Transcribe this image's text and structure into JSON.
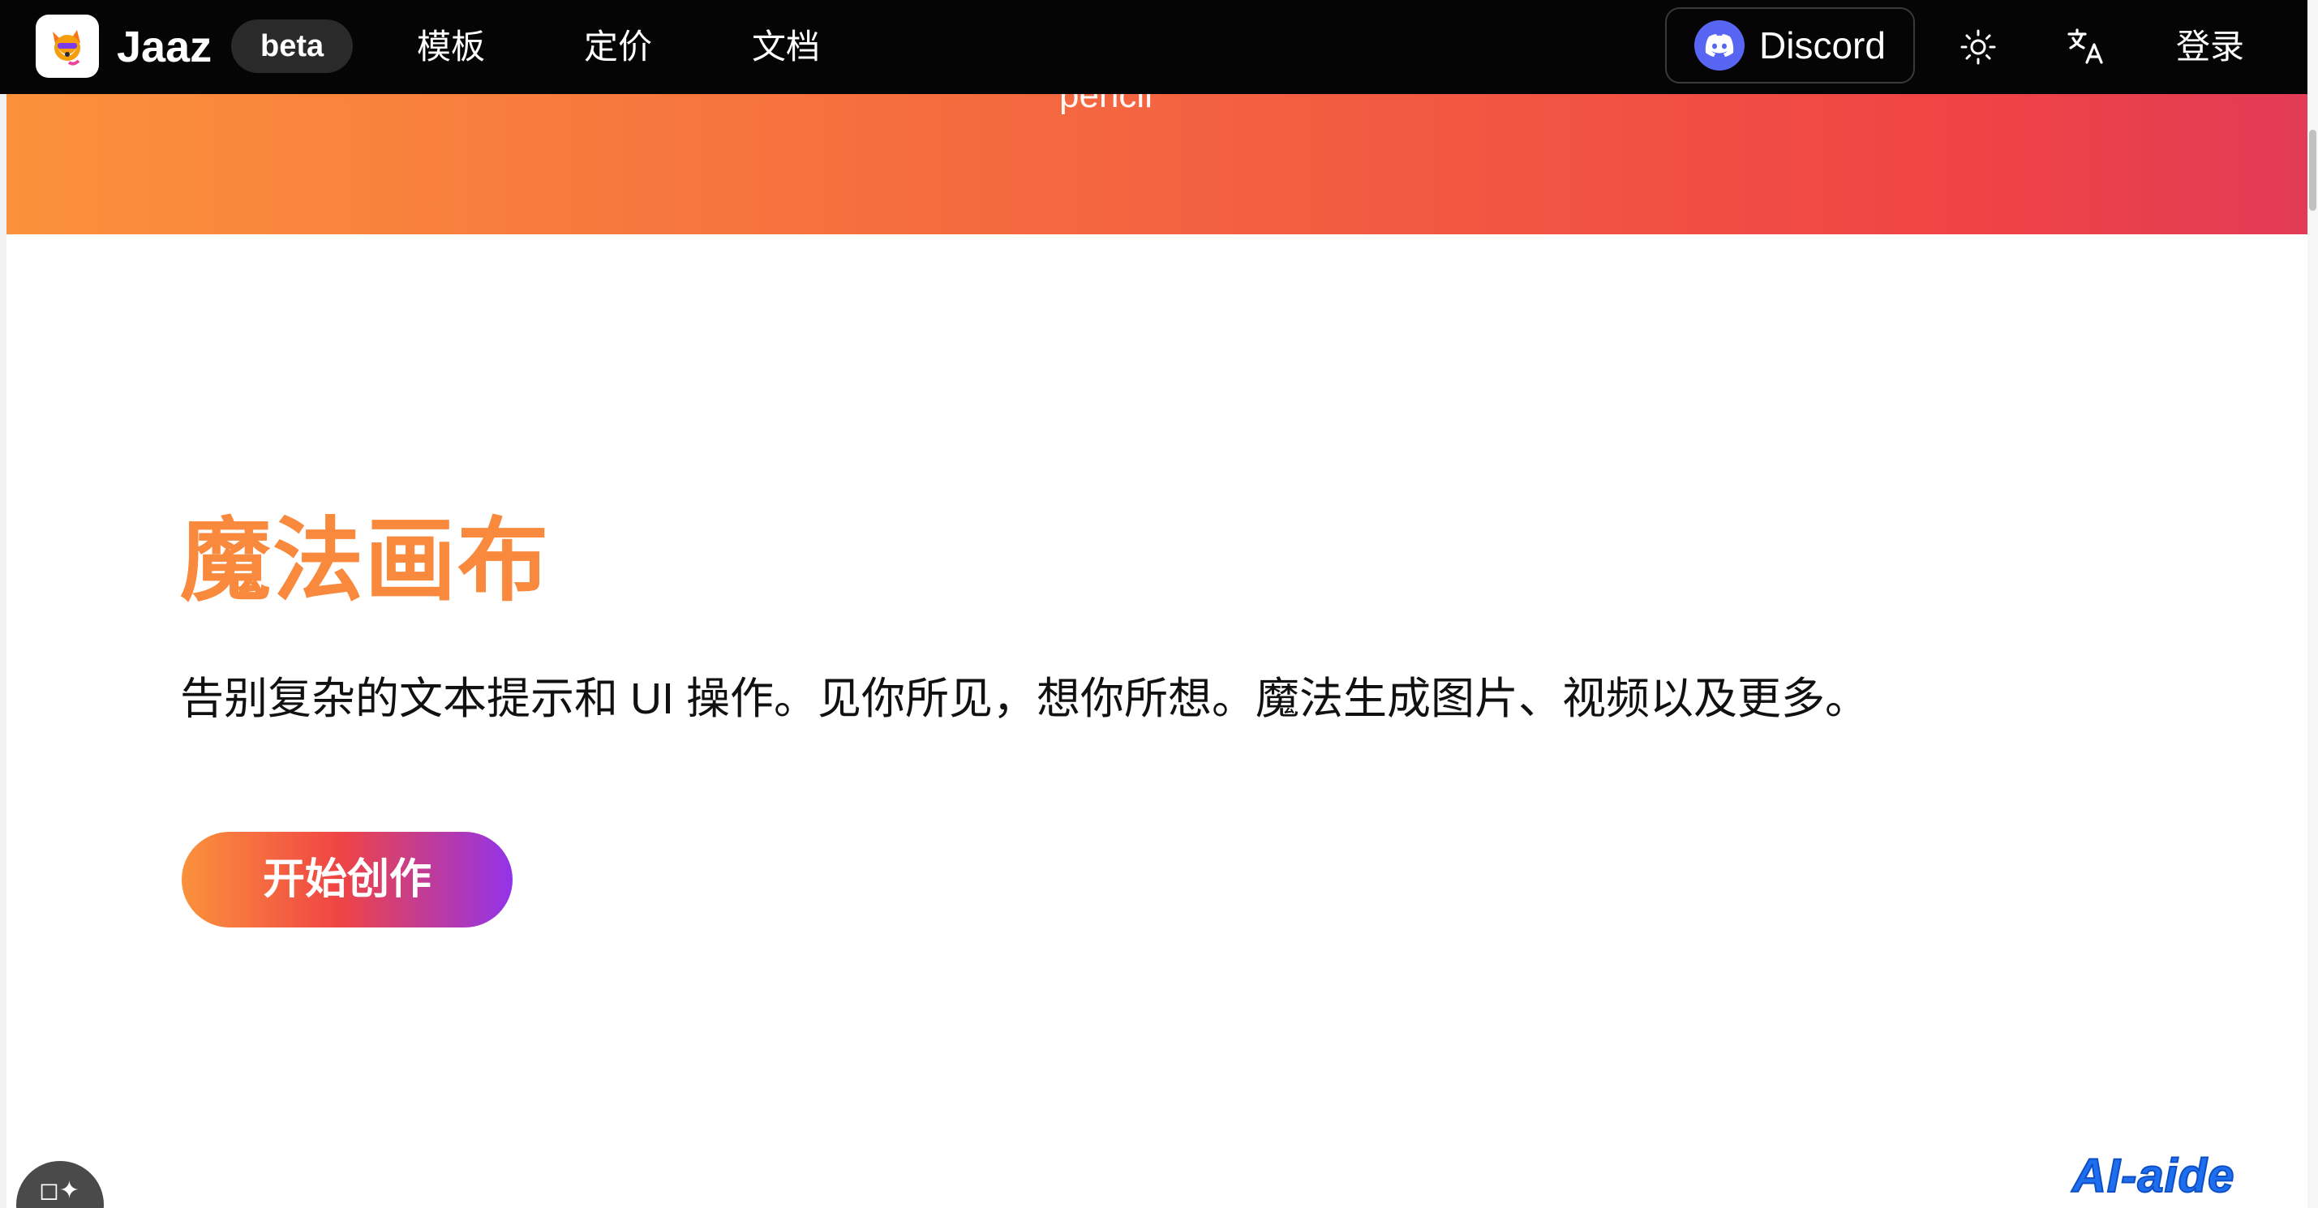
{
  "nav": {
    "brand": "Jaaz",
    "badge": "beta",
    "links": [
      "模板",
      "定价",
      "文档"
    ],
    "discord_label": "Discord",
    "login_label": "登录"
  },
  "banner": {
    "partial_text": "pencil"
  },
  "hero": {
    "title": "魔法画布",
    "subtitle": "告别复杂的文本提示和 UI 操作。见你所见，想你所想。魔法生成图片、视频以及更多。",
    "cta_label": "开始创作"
  },
  "fab": {
    "glyph": "◻✦"
  },
  "watermark": "AI-aide",
  "colors": {
    "nav_bg": "#050505",
    "accent_orange": "#f98a3d",
    "gradient_start": "#fb913b",
    "gradient_end": "#e23b55",
    "cta_end": "#9333ea",
    "discord_blue": "#5865f2"
  }
}
